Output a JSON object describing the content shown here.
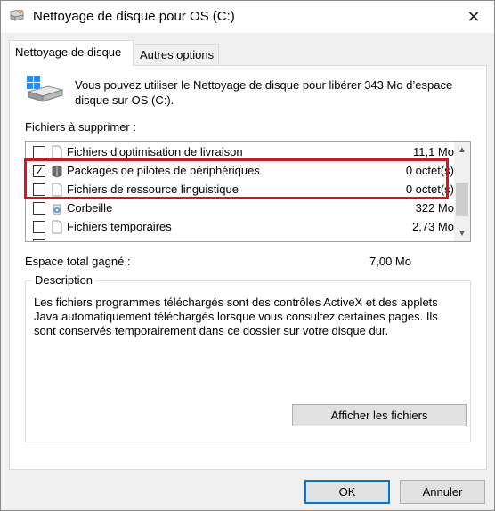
{
  "window": {
    "title": "Nettoyage de disque pour OS (C:)",
    "close_glyph": "✕"
  },
  "tabs": [
    {
      "label": "Nettoyage de disque",
      "active": true
    },
    {
      "label": "Autres options",
      "active": false
    }
  ],
  "header": {
    "message": "Vous pouvez utiliser le Nettoyage de disque pour libérer 343 Mo d’espace disque sur OS (C:).",
    "icon": "disk-cleanup-drive-icon"
  },
  "files_label": "Fichiers à supprimer :",
  "files": [
    {
      "label": "Fichiers d'optimisation de livraison",
      "size": "11,1 Mo",
      "checked": false,
      "icon": "document-icon"
    },
    {
      "label": "Packages de pilotes de périphériques",
      "size": "0 octet(s)",
      "checked": true,
      "icon": "driver-package-icon"
    },
    {
      "label": "Fichiers de ressource linguistique",
      "size": "0 octet(s)",
      "checked": false,
      "icon": "document-icon"
    },
    {
      "label": "Corbeille",
      "size": "322 Mo",
      "checked": false,
      "icon": "recycle-bin-icon"
    },
    {
      "label": "Fichiers temporaires",
      "size": "2,73 Mo",
      "checked": false,
      "icon": "document-icon"
    }
  ],
  "space_gained": {
    "label": "Espace total gagné :",
    "value": "7,00 Mo"
  },
  "description": {
    "title": "Description",
    "text": "Les fichiers programmes téléchargés sont des contrôles ActiveX et des applets Java automatiquement téléchargés lorsque vous consultez certaines pages. Ils sont conservés temporairement dans ce dossier sur votre disque dur."
  },
  "buttons": {
    "view_files": "Afficher les fichiers",
    "ok": "OK",
    "cancel": "Annuler"
  },
  "colors": {
    "highlight": "#e0101a",
    "default_button_border": "#0078d7"
  },
  "check_glyph": "✓"
}
